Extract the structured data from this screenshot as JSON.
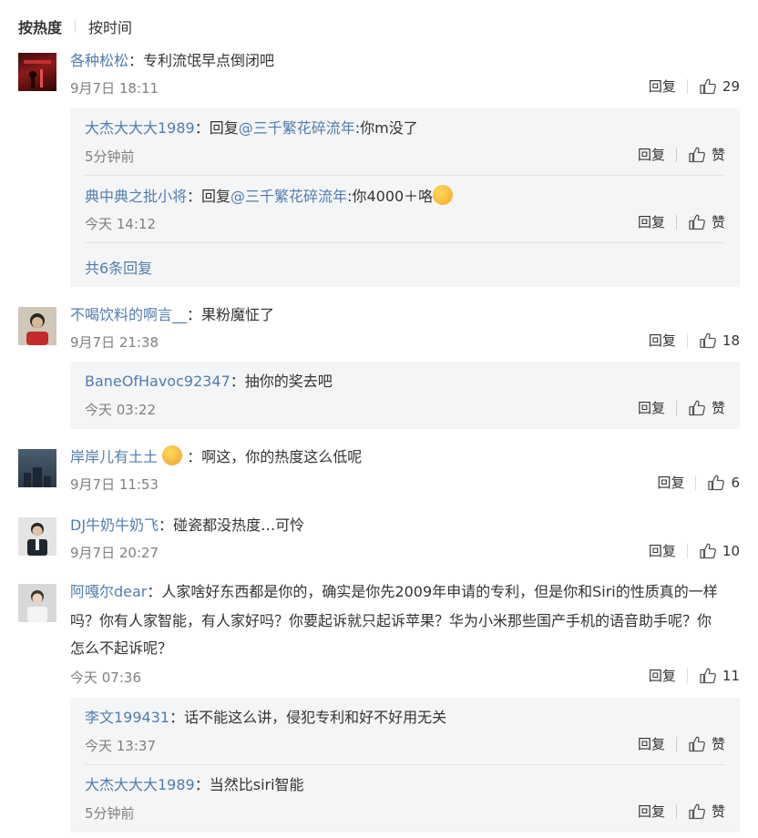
{
  "sort": {
    "hot": "按热度",
    "time": "按时间"
  },
  "labels": {
    "reply": "回复",
    "like": "赞"
  },
  "comments": [
    {
      "user": "各种松松",
      "text": "专利流氓早点倒闭吧",
      "time": "9月7日 18:11",
      "likes": "29",
      "replies": [
        {
          "user": "大杰大大大1989",
          "prefix": "回复",
          "mention": "@三千繁花碎流年",
          "text": ":你m没了",
          "time": "5分钟前"
        },
        {
          "user": "典中典之批小将",
          "prefix": "回复",
          "mention": "@三千繁花碎流年",
          "text": ":你4000＋咯",
          "time": "今天 14:12"
        }
      ],
      "more": "共6条回复"
    },
    {
      "user": "不喝饮料的啊言__",
      "text": "果粉魔怔了",
      "time": "9月7日 21:38",
      "likes": "18",
      "replies": [
        {
          "user": "BaneOfHavoc92347",
          "text": "抽你的奖去吧",
          "time": "今天 03:22"
        }
      ]
    },
    {
      "user": "岸岸儿有土土",
      "text": "啊这，你的热度这么低呢",
      "time": "9月7日 11:53",
      "likes": "6"
    },
    {
      "user": "DJ牛奶牛奶飞",
      "text": "碰瓷都没热度…可怜",
      "time": "9月7日 20:27",
      "likes": "10"
    },
    {
      "user": "阿嘎尔dear",
      "text": "人家啥好东西都是你的，确实是你先2009年申请的专利，但是你和Siri的性质真的一样",
      "text2": "吗？你有人家智能，有人家好吗？你要起诉就只起诉苹果？华为小米那些国产手机的语音助手呢？你",
      "text3": "怎么不起诉呢？",
      "time": "今天 07:36",
      "likes": "11",
      "replies": [
        {
          "user": "李文199431",
          "text": "话不能这么讲，侵犯专利和好不好用无关",
          "time": "今天 13:37"
        },
        {
          "user": "大杰大大大1989",
          "text": "当然比siri智能",
          "time": "5分钟前"
        }
      ]
    }
  ]
}
